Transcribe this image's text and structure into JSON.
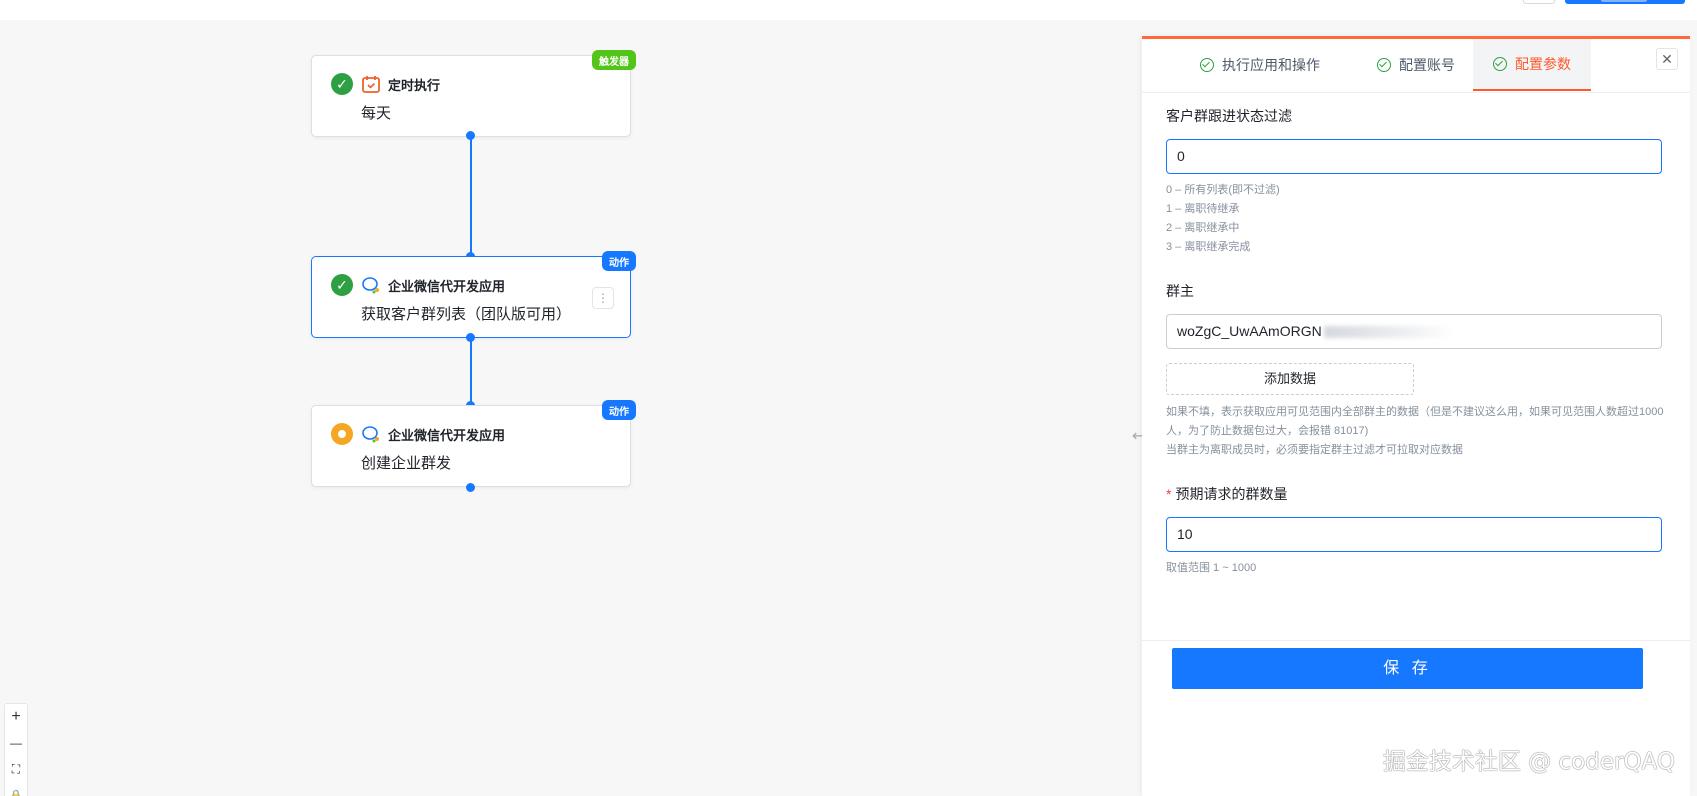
{
  "flow": {
    "nodes": [
      {
        "app": "定时执行",
        "action": "每天",
        "badge": "触发器",
        "status": "done",
        "icon": "calendar-icon"
      },
      {
        "app": "企业微信代开发应用",
        "action": "获取客户群列表（团队版可用）",
        "badge": "动作",
        "status": "done",
        "icon": "wecom-icon"
      },
      {
        "app": "企业微信代开发应用",
        "action": "创建企业群发",
        "badge": "动作",
        "status": "pending",
        "icon": "wecom-icon"
      }
    ],
    "more_icon": "⋮"
  },
  "zoom_controls": {
    "zoom_in": "+",
    "zoom_out": "—",
    "fit": "⛶",
    "lock": "🔒"
  },
  "panel": {
    "tabs": [
      "执行应用和操作",
      "配置账号",
      "配置参数"
    ],
    "active_tab": "配置参数",
    "close": "✕",
    "fields": {
      "status_filter": {
        "label": "客户群跟进状态过滤",
        "value": "0",
        "hints": [
          "0 – 所有列表(即不过滤)",
          "1 – 离职待继承",
          "2 – 离职继承中",
          "3 – 离职继承完成"
        ]
      },
      "owner": {
        "label": "群主",
        "value": "woZgC_UwAAmORGN",
        "add_button": "添加数据",
        "hints": [
          "如果不填，表示获取应用可见范围内全部群主的数据（但是不建议这么用，如果可见范围人数超过1000人，为了防止数据包过大，会报错 81017)",
          "当群主为离职成员时，必须要指定群主过滤才可拉取对应数据"
        ]
      },
      "limit": {
        "required_mark": "*",
        "label": "预期请求的群数量",
        "value": "10",
        "hint": "取值范围 1 ~ 1000"
      }
    },
    "save": "保 存"
  },
  "watermark": "掘金技术社区 @ coderQAQ",
  "colors": {
    "primary": "#1677ff",
    "success": "#2ea043",
    "pending": "#f5a623",
    "accent": "#ff5a2d",
    "trigger_badge": "#52c41a"
  }
}
